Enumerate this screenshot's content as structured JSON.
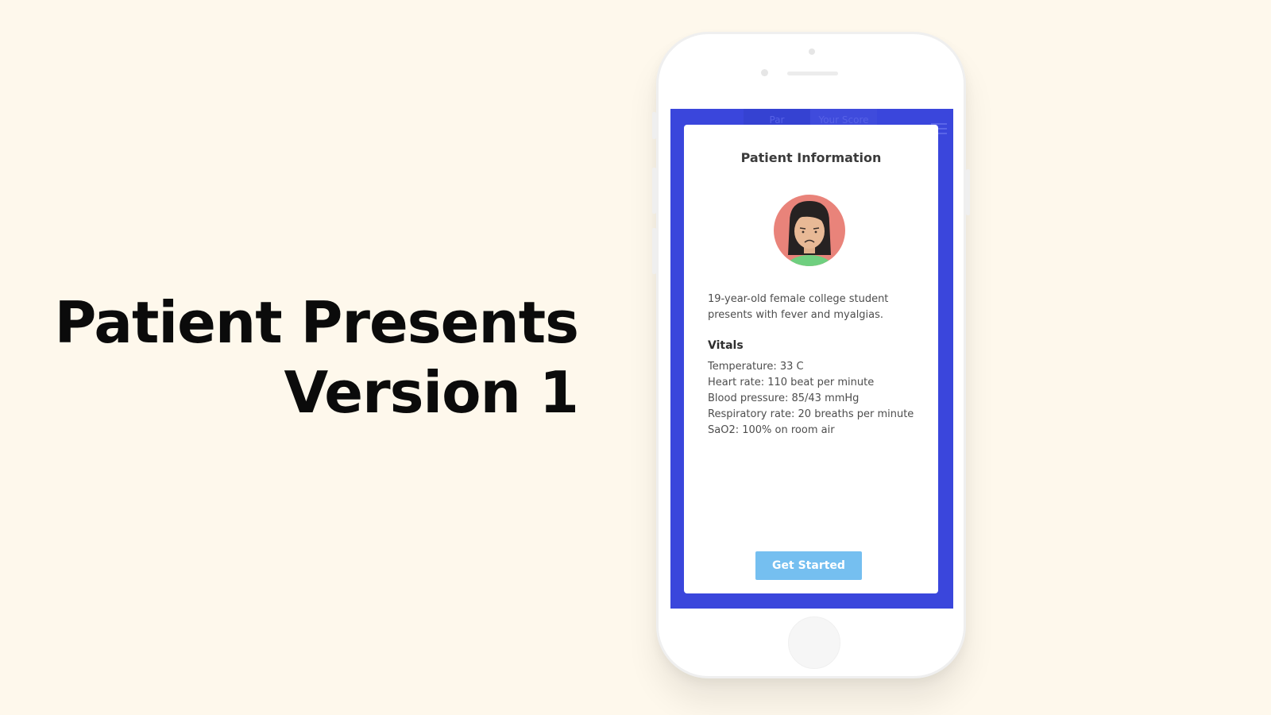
{
  "slide": {
    "title_line1": "Patient Presents",
    "title_line2": "Version 1"
  },
  "app": {
    "header_tabs": [
      "Par",
      "Your Score"
    ],
    "menu_icon": "hamburger-menu-icon"
  },
  "modal": {
    "title": "Patient Information",
    "avatar_icon": "female-patient-avatar-icon",
    "case_description": "19-year-old female college student presents with fever and myalgias.",
    "vitals_heading": "Vitals",
    "vitals": [
      "Temperature: 33 C",
      "Heart rate: 110 beat per minute",
      "Blood pressure: 85/43 mmHg",
      "Respiratory rate: 20 breaths per minute",
      "SaO2: 100% on room air"
    ],
    "button_label": "Get Started"
  },
  "colors": {
    "background": "#fef8ec",
    "screen_accent": "#3a46dc",
    "button": "#75bff0",
    "avatar_circle": "#e9837a",
    "avatar_shirt": "#6fcf7f"
  }
}
